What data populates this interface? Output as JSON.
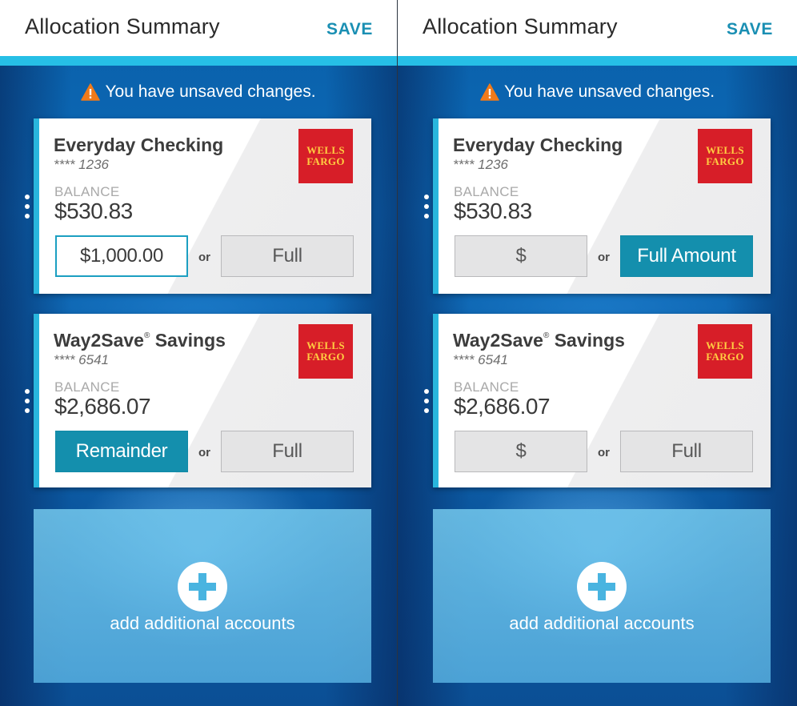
{
  "accent_color": "#1a8fb3",
  "panels": [
    {
      "header": {
        "title": "Allocation Summary",
        "save_label": "SAVE"
      },
      "warning": {
        "icon": "warning-triangle-icon",
        "text": "You have unsaved changes."
      },
      "accounts": [
        {
          "name": "Everyday Checking",
          "trademark": "",
          "name_suffix": "",
          "number": "**** 1236",
          "balance_label": "BALANCE",
          "balance": "$530.83",
          "logo_line1": "WELLS",
          "logo_line2": "FARGO",
          "amount": "$1,000.00",
          "or_label": "or",
          "full_label": "Full"
        },
        {
          "name": "Way2Save",
          "trademark": "®",
          "name_suffix": " Savings",
          "number": "**** 6541",
          "balance_label": "BALANCE",
          "balance": "$2,686.07",
          "logo_line1": "WELLS",
          "logo_line2": "FARGO",
          "amount": "Remainder",
          "or_label": "or",
          "full_label": "Full"
        }
      ],
      "add_accounts_label": "add additional accounts"
    },
    {
      "header": {
        "title": "Allocation Summary",
        "save_label": "SAVE"
      },
      "warning": {
        "icon": "warning-triangle-icon",
        "text": "You have unsaved changes."
      },
      "accounts": [
        {
          "name": "Everyday Checking",
          "trademark": "",
          "name_suffix": "",
          "number": "**** 1236",
          "balance_label": "BALANCE",
          "balance": "$530.83",
          "logo_line1": "WELLS",
          "logo_line2": "FARGO",
          "amount": "$",
          "or_label": "or",
          "full_label": "Full Amount"
        },
        {
          "name": "Way2Save",
          "trademark": "®",
          "name_suffix": " Savings",
          "number": "**** 6541",
          "balance_label": "BALANCE",
          "balance": "$2,686.07",
          "logo_line1": "WELLS",
          "logo_line2": "FARGO",
          "amount": "$",
          "or_label": "or",
          "full_label": "Full"
        }
      ],
      "add_accounts_label": "add additional accounts"
    }
  ]
}
